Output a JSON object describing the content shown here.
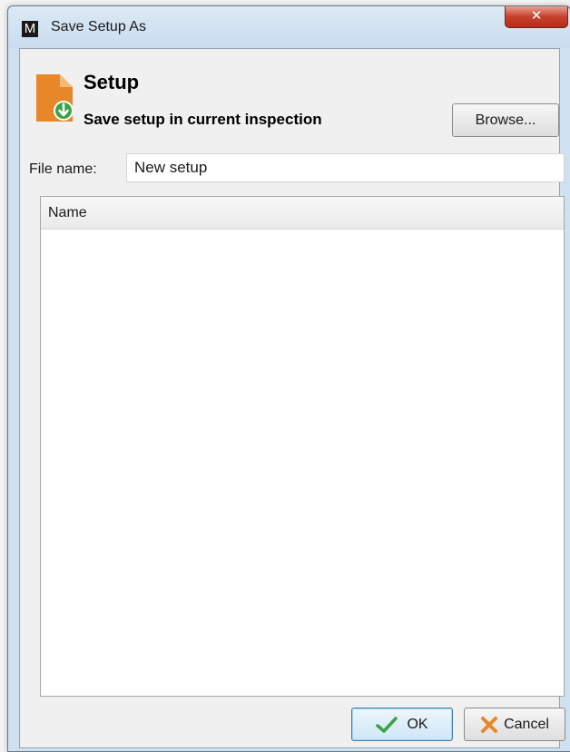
{
  "window": {
    "title": "Save Setup As",
    "app_icon_letter": "M",
    "close_glyph": "✕"
  },
  "header": {
    "title": "Setup",
    "subtitle": "Save setup in current inspection",
    "icon": "save-document-icon",
    "icon_color": "#e8862a",
    "badge_color": "#3aa347"
  },
  "toolbar": {
    "browse_label": "Browse..."
  },
  "file_name": {
    "label": "File name:",
    "value": "New setup"
  },
  "list": {
    "columns": [
      "Name"
    ],
    "rows": []
  },
  "footer": {
    "ok_label": "OK",
    "cancel_label": "Cancel",
    "ok_icon": "checkmark-icon",
    "cancel_icon": "cross-icon"
  }
}
